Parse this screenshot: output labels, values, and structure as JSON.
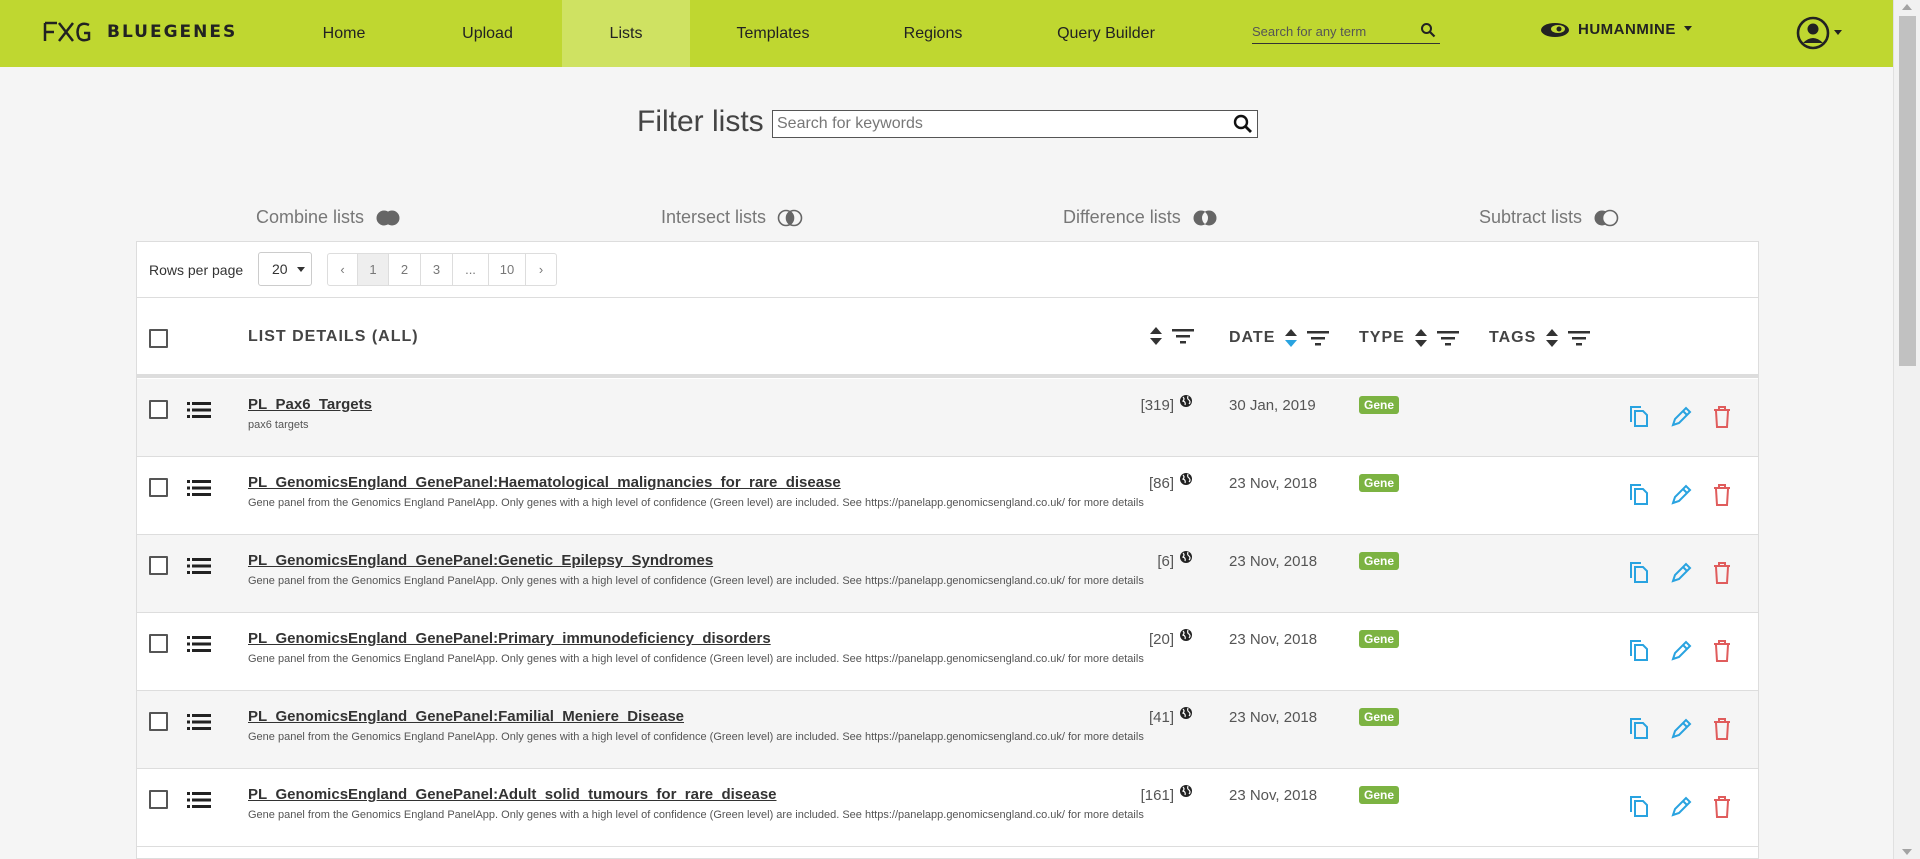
{
  "brand": {
    "name": "BLUEGENES",
    "logo_icon": "fxg-logo-icon"
  },
  "nav": {
    "items": [
      {
        "label": "Home",
        "active": false
      },
      {
        "label": "Upload",
        "active": false
      },
      {
        "label": "Lists",
        "active": true
      },
      {
        "label": "Templates",
        "active": false
      },
      {
        "label": "Regions",
        "active": false
      },
      {
        "label": "Query Builder",
        "active": false
      }
    ],
    "search_placeholder": "Search for any term",
    "mine_label": "HUMANMINE"
  },
  "filter": {
    "title": "Filter lists",
    "placeholder": "Search for keywords"
  },
  "operations": [
    {
      "label": "Combine lists",
      "icon": "union-venn-icon"
    },
    {
      "label": "Intersect lists",
      "icon": "intersect-venn-icon"
    },
    {
      "label": "Difference lists",
      "icon": "difference-venn-icon"
    },
    {
      "label": "Subtract lists",
      "icon": "subtract-venn-icon"
    }
  ],
  "pagination": {
    "rows_per_page_label": "Rows per page",
    "rows_per_page": "20",
    "prev": "‹",
    "pages": [
      "1",
      "2",
      "3",
      "...",
      "10"
    ],
    "current": "1",
    "next": "›"
  },
  "table": {
    "headers": {
      "details": "LIST DETAILS (ALL)",
      "date": "DATE",
      "type": "TYPE",
      "tags": "TAGS"
    },
    "rows": [
      {
        "title": "PL_Pax6_Targets",
        "desc": "pax6 targets",
        "count": "[319]",
        "date": "30 Jan, 2019",
        "type": "Gene"
      },
      {
        "title": "PL_GenomicsEngland_GenePanel:Haematological_malignancies_for_rare_disease",
        "desc": "Gene panel from the Genomics England PanelApp. Only genes with a high level of confidence (Green level) are included. See https://panelapp.genomicsengland.co.uk/ for more details",
        "count": "[86]",
        "date": "23 Nov, 2018",
        "type": "Gene"
      },
      {
        "title": "PL_GenomicsEngland_GenePanel:Genetic_Epilepsy_Syndromes",
        "desc": "Gene panel from the Genomics England PanelApp. Only genes with a high level of confidence (Green level) are included. See https://panelapp.genomicsengland.co.uk/ for more details",
        "count": "[6]",
        "date": "23 Nov, 2018",
        "type": "Gene"
      },
      {
        "title": "PL_GenomicsEngland_GenePanel:Primary_immunodeficiency_disorders",
        "desc": "Gene panel from the Genomics England PanelApp. Only genes with a high level of confidence (Green level) are included. See https://panelapp.genomicsengland.co.uk/ for more details",
        "count": "[20]",
        "date": "23 Nov, 2018",
        "type": "Gene"
      },
      {
        "title": "PL_GenomicsEngland_GenePanel:Familial_Meniere_Disease",
        "desc": "Gene panel from the Genomics England PanelApp. Only genes with a high level of confidence (Green level) are included. See https://panelapp.genomicsengland.co.uk/ for more details",
        "count": "[41]",
        "date": "23 Nov, 2018",
        "type": "Gene"
      },
      {
        "title": "PL_GenomicsEngland_GenePanel:Adult_solid_tumours_for_rare_disease",
        "desc": "Gene panel from the Genomics England PanelApp. Only genes with a high level of confidence (Green level) are included. See https://panelapp.genomicsengland.co.uk/ for more details",
        "count": "[161]",
        "date": "23 Nov, 2018",
        "type": "Gene"
      }
    ]
  },
  "colors": {
    "navbar": "#bfd730",
    "nav_active": "#cfe262",
    "badge": "#7cb342",
    "action_blue": "#29a3e0",
    "delete_red": "#e05c5c",
    "sort_active": "#29a3e0"
  }
}
